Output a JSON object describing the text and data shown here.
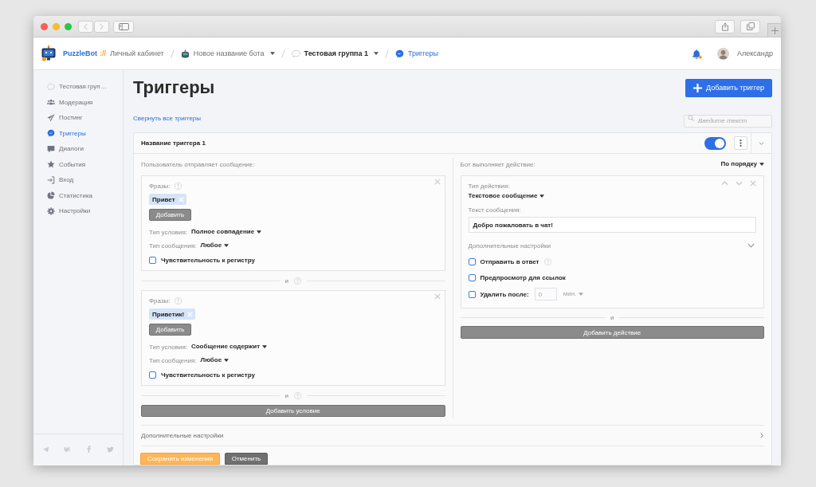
{
  "header": {
    "brand": "PuzzleBot",
    "brand_suffix": "://",
    "breadcrumbs": [
      {
        "label": "Личный кабинет",
        "kind": "home",
        "dropdown": false,
        "selected": false
      },
      {
        "label": "Новое название бота",
        "kind": "bot",
        "dropdown": true,
        "selected": false
      },
      {
        "label": "Тестовая группа 1",
        "kind": "group",
        "dropdown": true,
        "selected": false
      },
      {
        "label": "Триггеры",
        "kind": "page",
        "dropdown": false,
        "selected": true
      }
    ],
    "notifications": {
      "unread": true
    },
    "user": {
      "name": "Александр"
    }
  },
  "sidebar": {
    "items": [
      {
        "label": "Тестовая груп…",
        "kind": "group",
        "selected": false
      },
      {
        "label": "Модерация",
        "kind": "moderation",
        "selected": false
      },
      {
        "label": "Постинг",
        "kind": "posting",
        "selected": false
      },
      {
        "label": "Триггеры",
        "kind": "triggers",
        "selected": true
      },
      {
        "label": "Диалоги",
        "kind": "dialogs",
        "selected": false
      },
      {
        "label": "События",
        "kind": "events",
        "selected": false
      },
      {
        "label": "Вход",
        "kind": "login",
        "selected": false
      },
      {
        "label": "Статистика",
        "kind": "stats",
        "selected": false
      },
      {
        "label": "Настройки",
        "kind": "settings",
        "selected": false
      }
    ]
  },
  "page": {
    "title": "Триггеры",
    "add_button": "Добавить триггер",
    "collapse_link": "Свернуть все триггеры",
    "search": {
      "placeholder": "Введите текст"
    }
  },
  "triggers": [
    {
      "name": "Название триггера 1",
      "enabled": true,
      "conditions_label": "Пользователь отправляет сообщение:",
      "conditions": [
        {
          "phrases_label": "Фразы:",
          "phrases": [
            "Привет"
          ],
          "add_phrase": "Добавить",
          "condition_type_label": "Тип условия:",
          "condition_type": "Полное совпадение",
          "message_type_label": "Тип сообщения:",
          "message_type": "Любое",
          "case_sensitive_label": "Чувствительность к регистру",
          "case_sensitive": false,
          "joiner": "и"
        },
        {
          "phrases_label": "Фразы:",
          "phrases": [
            "Приветик!"
          ],
          "add_phrase": "Добавить",
          "condition_type_label": "Тип условия:",
          "condition_type": "Сообщение содержит",
          "message_type_label": "Тип сообщения:",
          "message_type": "Любое",
          "case_sensitive_label": "Чувствительность к регистру",
          "case_sensitive": false,
          "joiner": "и"
        }
      ],
      "add_condition": "Добавить условие",
      "actions_label": "Бот выполняет действие:",
      "order": "По порядку",
      "actions": [
        {
          "type_label": "Тип действия:",
          "type": "Текстовое сообщение",
          "text_label": "Текст сообщения:",
          "text": "Добро пожаловать в чат!",
          "settings_label": "Дополнительные настройки",
          "options": [
            {
              "label": "Отправить в ответ",
              "kind": "help",
              "checked": false
            },
            {
              "label": "Предпросмотр для ссылок",
              "kind": "plain",
              "checked": false
            },
            {
              "label": "Удалить после:",
              "kind": "delay",
              "checked": false,
              "placeholder": "0",
              "unit": "мин."
            }
          ],
          "joiner": "и"
        }
      ],
      "add_action": "Добавить действие",
      "extra_settings": "Дополнительные настройки",
      "save": "Сохранить изменения",
      "cancel": "Отменить"
    }
  ]
}
